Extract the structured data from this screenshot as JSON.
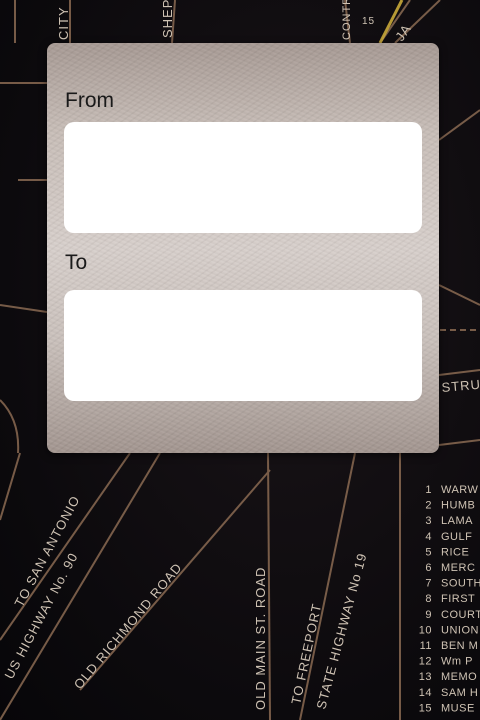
{
  "route_form": {
    "from_label": "From",
    "from_value": "",
    "from_placeholder": "",
    "to_label": "To",
    "to_value": "",
    "to_placeholder": ""
  },
  "map": {
    "street_labels": [
      "TO SAN ANTONIO",
      "US HIGHWAY No. 90",
      "OLD RICHMOND ROAD",
      "OLD MAIN ST. ROAD",
      "TO FREEPORT",
      "STATE HIGHWAY No 19",
      "CITY",
      "SHEP",
      "CONTRA",
      "15",
      "JA",
      "STRU"
    ],
    "legend_items": [
      {
        "num": "1",
        "name": "WARW"
      },
      {
        "num": "2",
        "name": "HUMB"
      },
      {
        "num": "3",
        "name": "LAMA"
      },
      {
        "num": "4",
        "name": "GULF"
      },
      {
        "num": "5",
        "name": "RICE"
      },
      {
        "num": "6",
        "name": "MERC"
      },
      {
        "num": "7",
        "name": "SOUTH"
      },
      {
        "num": "8",
        "name": "FIRST"
      },
      {
        "num": "9",
        "name": "COURT"
      },
      {
        "num": "10",
        "name": "UNION"
      },
      {
        "num": "11",
        "name": "BEN M"
      },
      {
        "num": "12",
        "name": "Wm P"
      },
      {
        "num": "13",
        "name": "MEMO"
      },
      {
        "num": "14",
        "name": "SAM H"
      },
      {
        "num": "15",
        "name": "MUSE"
      }
    ]
  }
}
